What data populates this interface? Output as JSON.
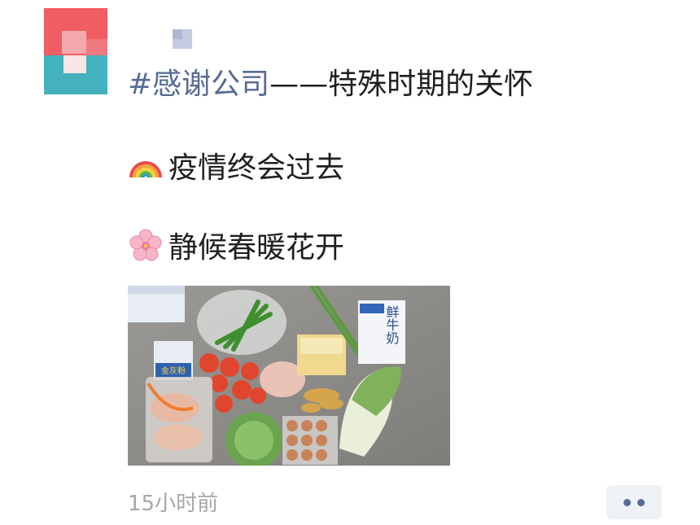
{
  "post": {
    "lines": [
      {
        "tag": "#感谢公司",
        "text": "——特殊时期的关怀"
      },
      {
        "emoji": "rainbow-emoji",
        "text": "疫情终会过去"
      },
      {
        "emoji": "cherry-blossom-emoji",
        "text": "静候春暖花开"
      }
    ],
    "photo": {
      "package_label": "鲜牛奶",
      "noodles_label": "金灰粉"
    },
    "timestamp": "15小时前"
  },
  "colors": {
    "link": "#576b95",
    "text": "#1f1f1f",
    "muted": "#a7a7a7",
    "button_bg": "#eef1f5"
  }
}
